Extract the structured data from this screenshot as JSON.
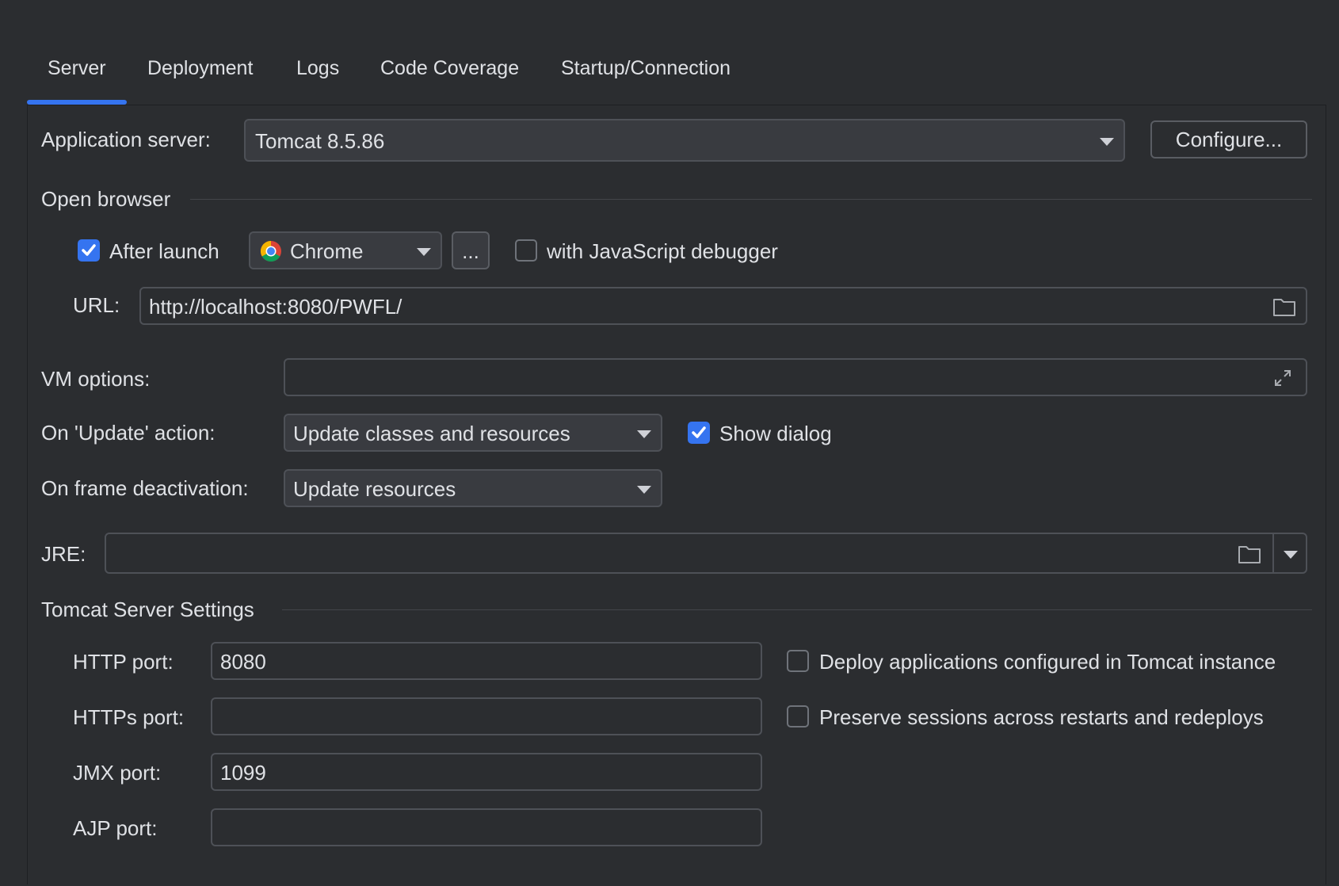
{
  "tabs": [
    {
      "label": "Server",
      "active": true
    },
    {
      "label": "Deployment",
      "active": false
    },
    {
      "label": "Logs",
      "active": false
    },
    {
      "label": "Code Coverage",
      "active": false
    },
    {
      "label": "Startup/Connection",
      "active": false
    }
  ],
  "app_server": {
    "label": "Application server:",
    "value": "Tomcat 8.5.86",
    "configure_label": "Configure..."
  },
  "open_browser": {
    "section_label": "Open browser",
    "after_launch_label": "After launch",
    "after_launch_checked": true,
    "browser_value": "Chrome",
    "more_label": "...",
    "js_debugger_label": "with JavaScript debugger",
    "js_debugger_checked": false,
    "url_label": "URL:",
    "url_value": "http://localhost:8080/PWFL/"
  },
  "vm_options": {
    "label": "VM options:",
    "value": ""
  },
  "on_update": {
    "label": "On 'Update' action:",
    "value": "Update classes and resources",
    "show_dialog_label": "Show dialog",
    "show_dialog_checked": true
  },
  "on_frame": {
    "label": "On frame deactivation:",
    "value": "Update resources"
  },
  "jre": {
    "label": "JRE:",
    "value": ""
  },
  "tomcat": {
    "section_label": "Tomcat Server Settings",
    "http_label": "HTTP port:",
    "http_value": "8080",
    "https_label": "HTTPs port:",
    "https_value": "",
    "jmx_label": "JMX port:",
    "jmx_value": "1099",
    "ajp_label": "AJP port:",
    "ajp_value": "",
    "deploy_label": "Deploy applications configured in Tomcat instance",
    "deploy_checked": false,
    "preserve_label": "Preserve sessions across restarts and redeploys",
    "preserve_checked": false
  },
  "colors": {
    "accent": "#3574f0",
    "background": "#2b2d30"
  }
}
